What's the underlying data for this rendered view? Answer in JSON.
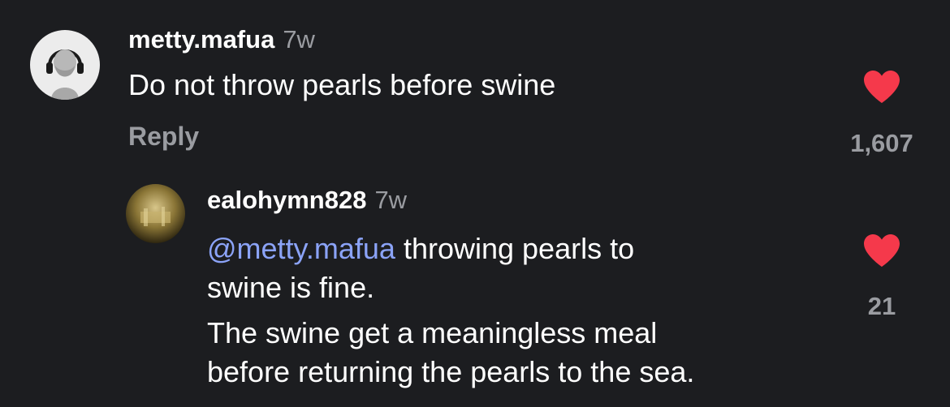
{
  "comments": [
    {
      "username": "metty.mafua",
      "time": "7w",
      "text": "Do not throw pearls before swine",
      "reply_label": "Reply",
      "like_count": "1,607",
      "like_color": "#f5394b"
    },
    {
      "username": "ealohymn828",
      "time": "7w",
      "mention": "@metty.mafua",
      "text_line1_rest": " throwing pearls to",
      "text_line2": "swine is fine.",
      "text_para2_line1": "The swine get a meaningless meal",
      "text_para2_line2": "before returning the pearls to the sea.",
      "like_count": "21",
      "like_color": "#f5394b"
    }
  ],
  "colors": {
    "background": "#1c1d20",
    "secondary_text": "#9a9ca1",
    "mention": "#8ba3f7",
    "heart": "#f5394b"
  }
}
